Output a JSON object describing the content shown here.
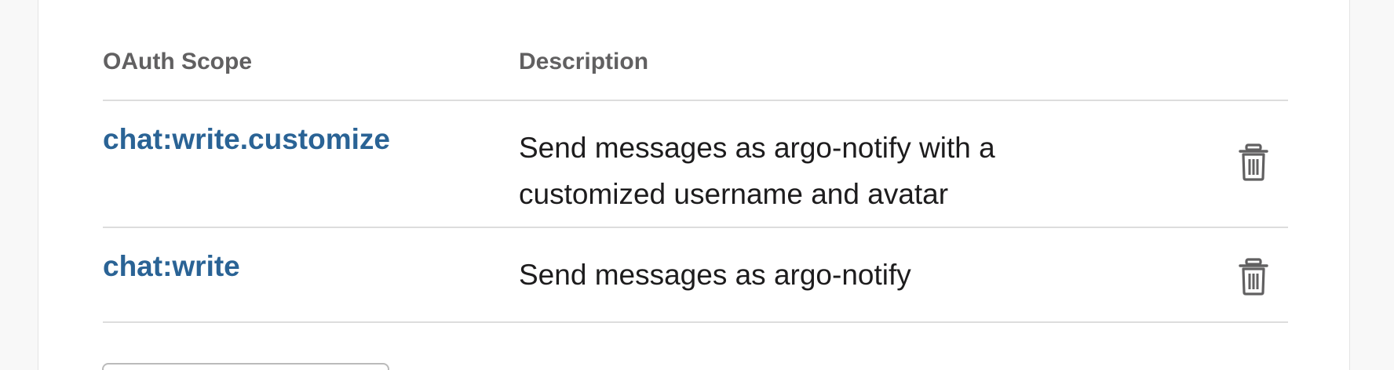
{
  "table": {
    "headers": {
      "scope": "OAuth Scope",
      "description": "Description"
    },
    "rows": [
      {
        "scope": "chat:write.customize",
        "description": "Send messages as argo-notify with a customized username and avatar",
        "delete_icon": "trash-icon"
      },
      {
        "scope": "chat:write",
        "description": "Send messages as argo-notify",
        "delete_icon": "trash-icon"
      }
    ]
  },
  "colors": {
    "link": "#2a6395",
    "header_text": "#616061",
    "body_text": "#1d1c1d",
    "divider": "#dddddd"
  }
}
